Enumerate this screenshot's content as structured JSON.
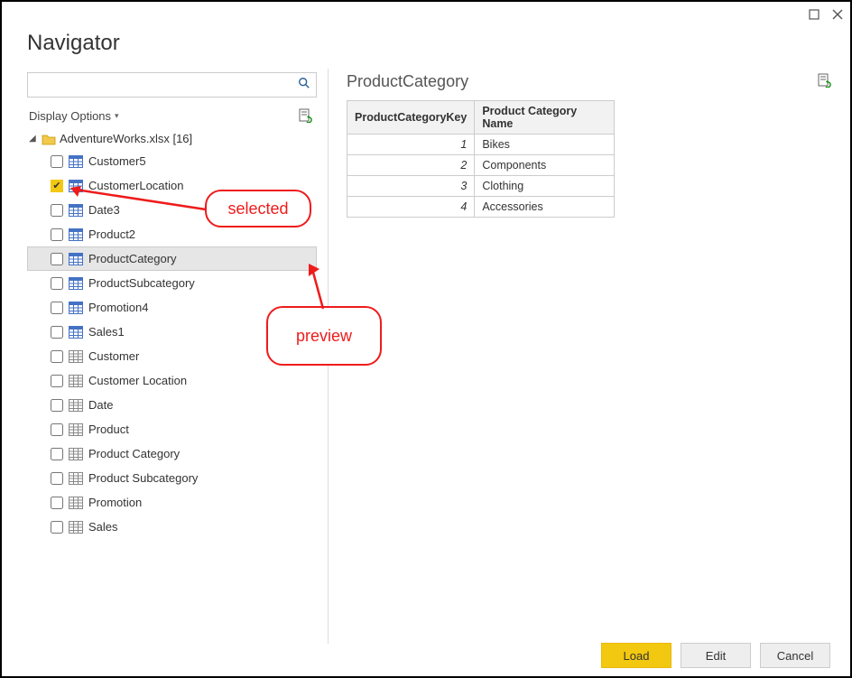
{
  "window": {
    "title": "Navigator"
  },
  "search": {
    "placeholder": ""
  },
  "display_options_label": "Display Options",
  "tree": {
    "root_label": "AdventureWorks.xlsx [16]",
    "items": [
      {
        "label": "Customer5",
        "checked": false,
        "type": "named",
        "highlight": false
      },
      {
        "label": "CustomerLocation",
        "checked": true,
        "type": "named",
        "highlight": false
      },
      {
        "label": "Date3",
        "checked": false,
        "type": "named",
        "highlight": false
      },
      {
        "label": "Product2",
        "checked": false,
        "type": "named",
        "highlight": false
      },
      {
        "label": "ProductCategory",
        "checked": false,
        "type": "named",
        "highlight": true
      },
      {
        "label": "ProductSubcategory",
        "checked": false,
        "type": "named",
        "highlight": false
      },
      {
        "label": "Promotion4",
        "checked": false,
        "type": "named",
        "highlight": false
      },
      {
        "label": "Sales1",
        "checked": false,
        "type": "named",
        "highlight": false
      },
      {
        "label": "Customer",
        "checked": false,
        "type": "sheet",
        "highlight": false
      },
      {
        "label": "Customer Location",
        "checked": false,
        "type": "sheet",
        "highlight": false
      },
      {
        "label": "Date",
        "checked": false,
        "type": "sheet",
        "highlight": false
      },
      {
        "label": "Product",
        "checked": false,
        "type": "sheet",
        "highlight": false
      },
      {
        "label": "Product Category",
        "checked": false,
        "type": "sheet",
        "highlight": false
      },
      {
        "label": "Product Subcategory",
        "checked": false,
        "type": "sheet",
        "highlight": false
      },
      {
        "label": "Promotion",
        "checked": false,
        "type": "sheet",
        "highlight": false
      },
      {
        "label": "Sales",
        "checked": false,
        "type": "sheet",
        "highlight": false
      }
    ]
  },
  "preview": {
    "title": "ProductCategory",
    "columns": [
      "ProductCategoryKey",
      "Product Category Name"
    ],
    "rows": [
      {
        "key": "1",
        "name": "Bikes"
      },
      {
        "key": "2",
        "name": "Components"
      },
      {
        "key": "3",
        "name": "Clothing"
      },
      {
        "key": "4",
        "name": "Accessories"
      }
    ]
  },
  "footer": {
    "load": "Load",
    "edit": "Edit",
    "cancel": "Cancel"
  },
  "annotations": {
    "selected": "selected",
    "preview": "preview"
  }
}
